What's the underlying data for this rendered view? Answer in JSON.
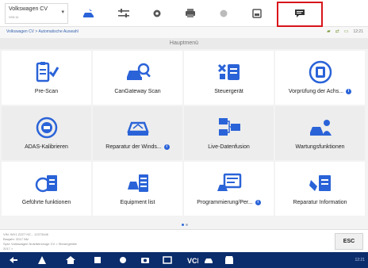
{
  "vehicle": {
    "name": "Volkswagen CV",
    "sub": "V03.11"
  },
  "breadcrumb": "Volkswagen CV > Automatische Auswahl",
  "header_status_text": "12:21",
  "panel_title": "Hauptmenü",
  "tiles": [
    {
      "label": "Pre-Scan",
      "icon": "clipboard-check-icon",
      "info": false
    },
    {
      "label": "CanGateway Scan",
      "icon": "car-search-icon",
      "info": false
    },
    {
      "label": "Steuergerät",
      "icon": "ecu-list-icon",
      "info": false
    },
    {
      "label": "Vorprüfung der Achs...",
      "icon": "axle-check-icon",
      "info": true
    },
    {
      "label": "ADAS-Kalibrieren",
      "icon": "adas-icon",
      "info": false
    },
    {
      "label": "Reparatur der Winds...",
      "icon": "windshield-car-icon",
      "info": true
    },
    {
      "label": "Live-Datenfusion",
      "icon": "data-fusion-icon",
      "info": false
    },
    {
      "label": "Wartungsfunktionen",
      "icon": "maintenance-car-icon",
      "info": false
    },
    {
      "label": "Geführte funktionen",
      "icon": "guided-functions-icon",
      "info": false
    },
    {
      "label": "Equipment list",
      "icon": "equipment-list-icon",
      "info": false
    },
    {
      "label": "Programmierung/Per...",
      "icon": "programming-icon",
      "info": true
    },
    {
      "label": "Reparatur Information",
      "icon": "repair-info-icon",
      "info": false
    }
  ],
  "status_lines": [
    "VIN: WV1 ZZZ7 HZ... 12273446",
    "Baujahr: 2017 Nfz",
    "Syst: Volkswagen Nutzfahrzeuge CV > Steuergeräte",
    "2017 >"
  ],
  "esc_label": "ESC",
  "nav_time": "12:21",
  "colors": {
    "accent_blue": "#2a63d8",
    "highlight_red": "#d8141b",
    "navbar": "#0c2d6b"
  }
}
